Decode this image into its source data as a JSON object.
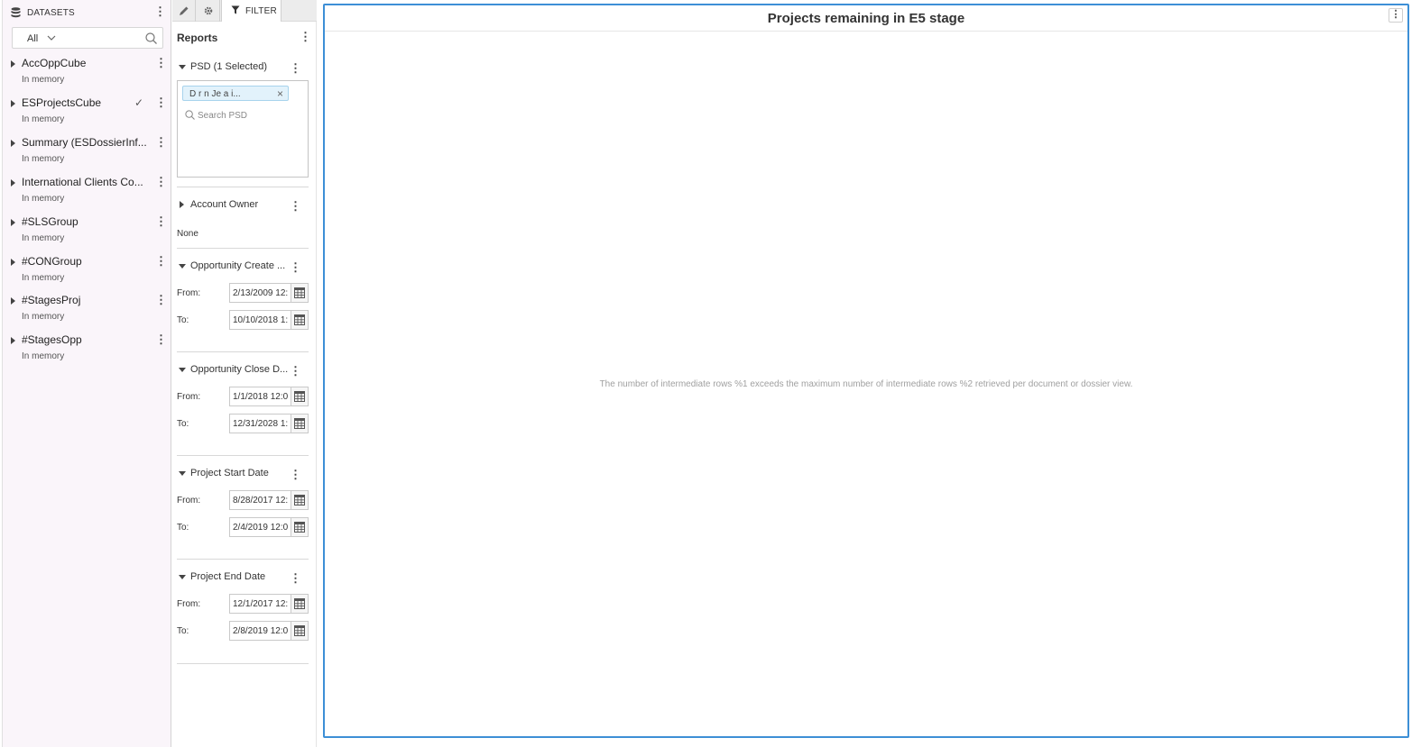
{
  "datasets": {
    "header": "DATASETS",
    "filter_value": "All",
    "items": [
      {
        "name": "AccOppCube",
        "status": "In memory",
        "selected": false
      },
      {
        "name": "ESProjectsCube",
        "status": "In memory",
        "selected": true
      },
      {
        "name": "Summary (ESDossierInf...",
        "status": "In memory",
        "selected": false
      },
      {
        "name": "International Clients Co...",
        "status": "In memory",
        "selected": false
      },
      {
        "name": "#SLSGroup",
        "status": "In memory",
        "selected": false
      },
      {
        "name": "#CONGroup",
        "status": "In memory",
        "selected": false
      },
      {
        "name": "#StagesProj",
        "status": "In memory",
        "selected": false
      },
      {
        "name": "#StagesOpp",
        "status": "In memory",
        "selected": false
      }
    ],
    "checkmark": "✓"
  },
  "filter_panel": {
    "tabs": {
      "edit_icon": "pencil-icon",
      "format_icon": "gear-icon",
      "filter_label": "FILTER"
    },
    "title": "Reports",
    "psd": {
      "label": "PSD (1 Selected)",
      "chip": "D r n Je a i...",
      "chip_remove": "×",
      "search_placeholder": "Search PSD"
    },
    "account_owner": {
      "label": "Account Owner",
      "value": "None"
    },
    "date_filters": [
      {
        "label": "Opportunity Create ...",
        "from_label": "From:",
        "from": "2/13/2009 12:",
        "to_label": "To:",
        "to": "10/10/2018 1:"
      },
      {
        "label": "Opportunity Close D...",
        "from_label": "From:",
        "from": "1/1/2018 12:0",
        "to_label": "To:",
        "to": "12/31/2028 1:"
      },
      {
        "label": "Project Start Date",
        "from_label": "From:",
        "from": "8/28/2017 12:",
        "to_label": "To:",
        "to": "2/4/2019 12:0"
      },
      {
        "label": "Project End Date",
        "from_label": "From:",
        "from": "12/1/2017 12:",
        "to_label": "To:",
        "to": "2/8/2019 12:0"
      }
    ]
  },
  "visualization": {
    "title": "Projects remaining in E5 stage",
    "message": "The number of intermediate rows %1 exceeds the maximum number of intermediate rows %2 retrieved per document or dossier view.",
    "accent": "#3d8fd6"
  }
}
